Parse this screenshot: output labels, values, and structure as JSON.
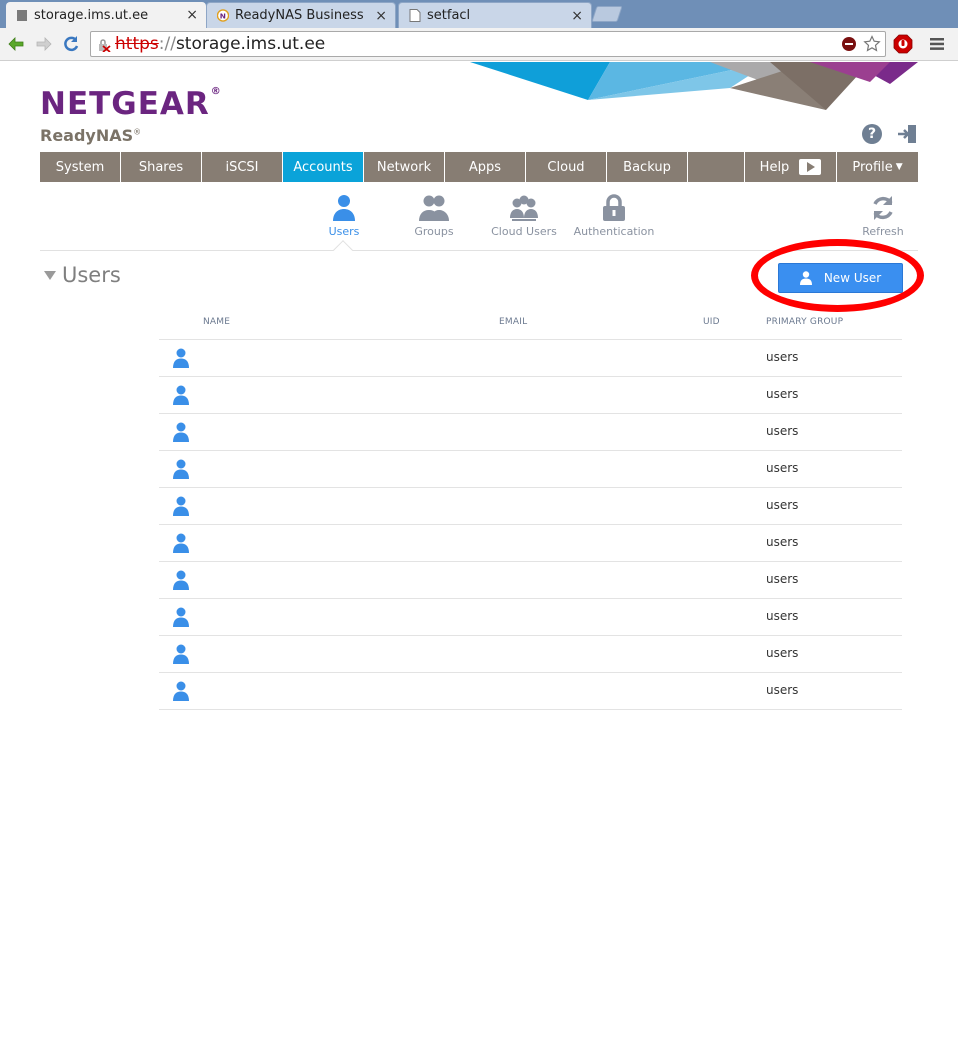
{
  "browser": {
    "tabs": [
      {
        "title": "storage.ims.ut.ee",
        "active": true
      },
      {
        "title": "ReadyNAS Business Rac",
        "active": false
      },
      {
        "title": "setfacl",
        "active": false
      }
    ],
    "close_glyph": "×",
    "url_scheme": "https",
    "url_sep": "://",
    "url_host": "storage.ims.ut.ee"
  },
  "brand": {
    "name": "NETGEAR",
    "reg": "®",
    "product": "ReadyNAS",
    "product_reg": "®",
    "colors": {
      "purple": "#6b2580",
      "nav": "#877d73",
      "accent": "#0aa3d9",
      "blue": "#3a8fe8"
    }
  },
  "header_icons": {
    "help": "?"
  },
  "mainnav": {
    "items": [
      {
        "label": "System"
      },
      {
        "label": "Shares"
      },
      {
        "label": "iSCSI"
      },
      {
        "label": "Accounts",
        "active": true
      },
      {
        "label": "Network"
      },
      {
        "label": "Apps"
      },
      {
        "label": "Cloud"
      },
      {
        "label": "Backup"
      },
      {
        "label": ""
      },
      {
        "label": "Help"
      },
      {
        "label": "Profile"
      }
    ],
    "caret": "▼"
  },
  "subnav": {
    "users": "Users",
    "groups": "Groups",
    "cloud_users": "Cloud Users",
    "authentication": "Authentication",
    "refresh": "Refresh"
  },
  "section": {
    "title": "Users",
    "new_user_label": "New User"
  },
  "table": {
    "headers": {
      "name": "NAME",
      "email": "EMAIL",
      "uid": "UID",
      "group": "PRIMARY GROUP"
    },
    "rows": [
      {
        "group": "users"
      },
      {
        "group": "users"
      },
      {
        "group": "users"
      },
      {
        "group": "users"
      },
      {
        "group": "users"
      },
      {
        "group": "users"
      },
      {
        "group": "users"
      },
      {
        "group": "users"
      },
      {
        "group": "users"
      },
      {
        "group": "users"
      }
    ]
  }
}
